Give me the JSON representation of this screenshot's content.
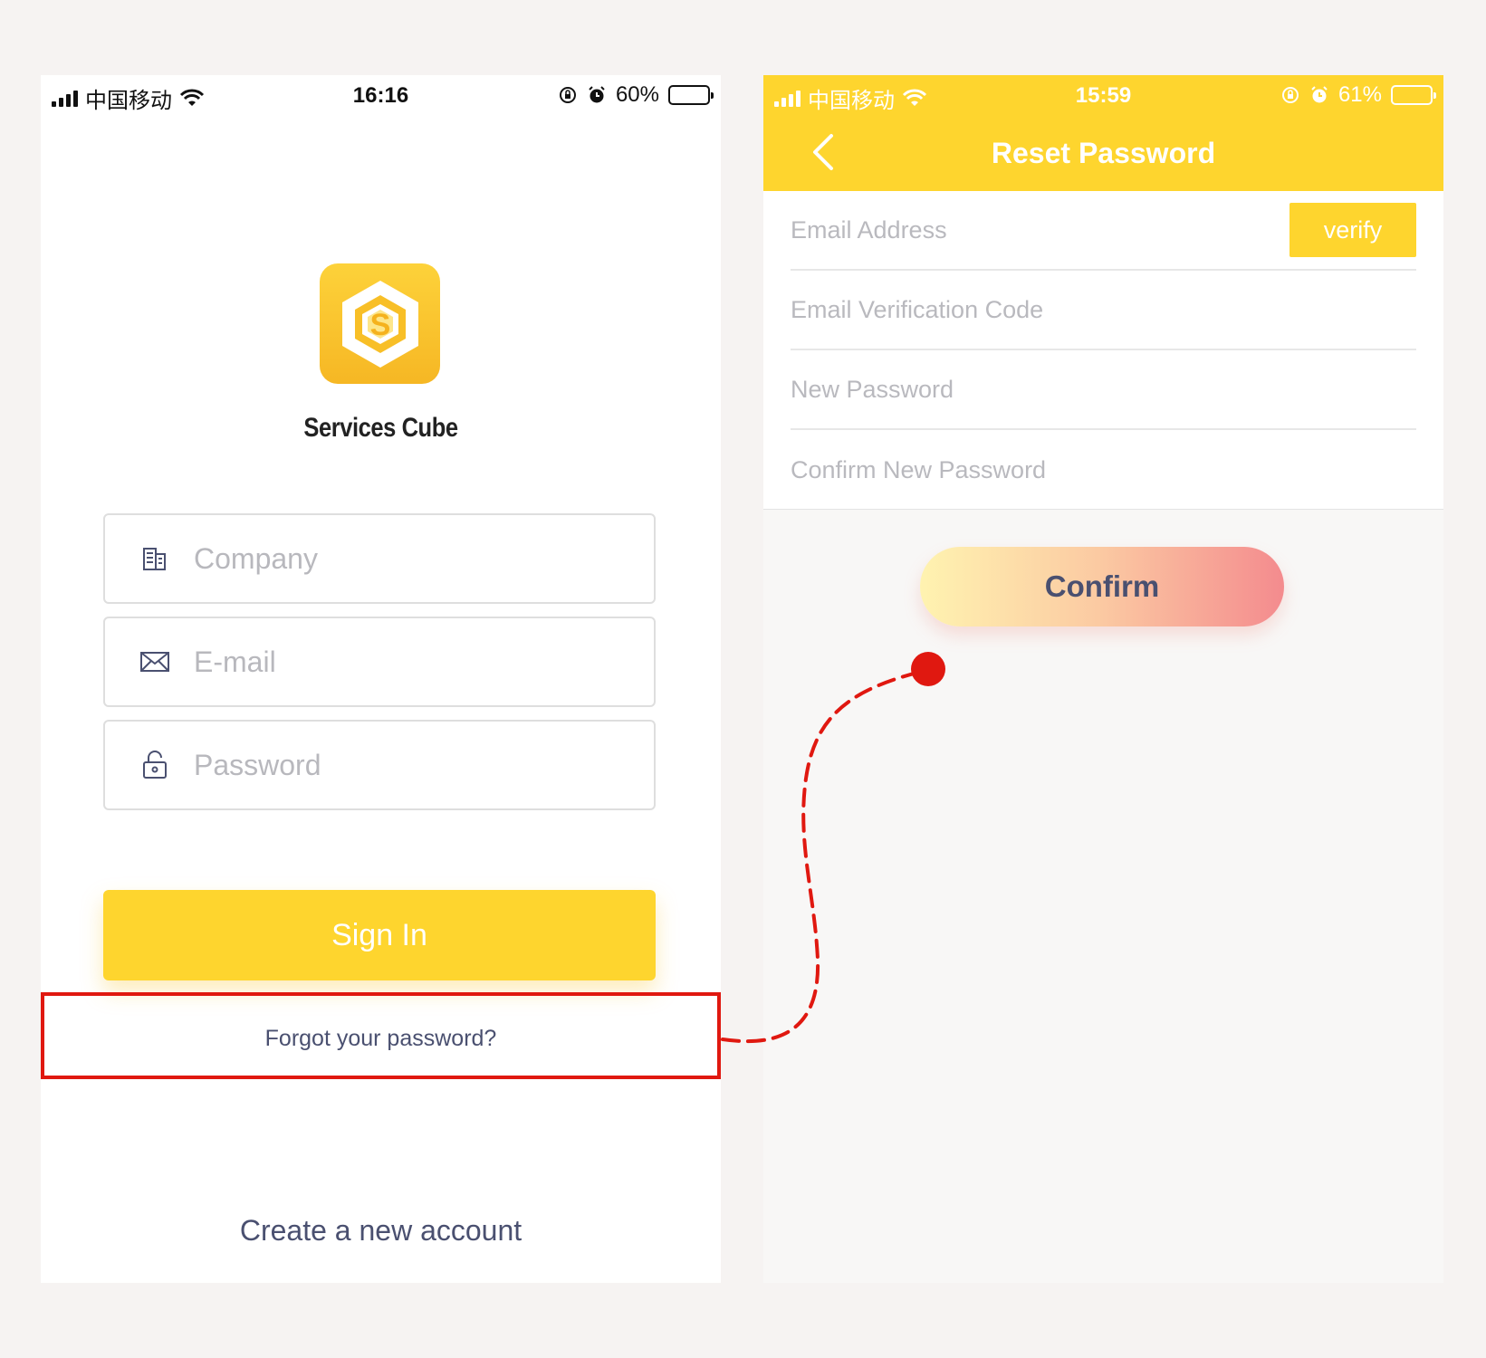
{
  "left_screen": {
    "status_bar": {
      "carrier": "中国移动",
      "time": "16:16",
      "battery_percent": "60%",
      "battery_level": 0.6
    },
    "app_name": "Services Cube",
    "logo_letter": "S",
    "fields": {
      "company_placeholder": "Company",
      "email_placeholder": "E-mail",
      "password_placeholder": "Password"
    },
    "sign_in_label": "Sign In",
    "forgot_password_label": "Forgot your password?",
    "create_account_label": "Create a new account"
  },
  "right_screen": {
    "status_bar": {
      "carrier": "中国移动",
      "time": "15:59",
      "battery_percent": "61%",
      "battery_level": 0.61
    },
    "title": "Reset Password",
    "fields": {
      "email_placeholder": "Email Address",
      "verification_code_placeholder": "Email Verification Code",
      "new_password_placeholder": "New Password",
      "confirm_password_placeholder": "Confirm New Password"
    },
    "verify_label": "verify",
    "confirm_label": "Confirm"
  },
  "colors": {
    "brand_yellow": "#fed52e",
    "text_dark": "#4a5070",
    "annotation_red": "#e01810",
    "background": "#f6f3f2"
  },
  "icons": [
    "signal-icon",
    "wifi-icon",
    "lock-rotation-icon",
    "alarm-icon",
    "battery-icon",
    "cube-logo-icon",
    "company-icon",
    "envelope-icon",
    "padlock-icon",
    "back-arrow-icon"
  ]
}
